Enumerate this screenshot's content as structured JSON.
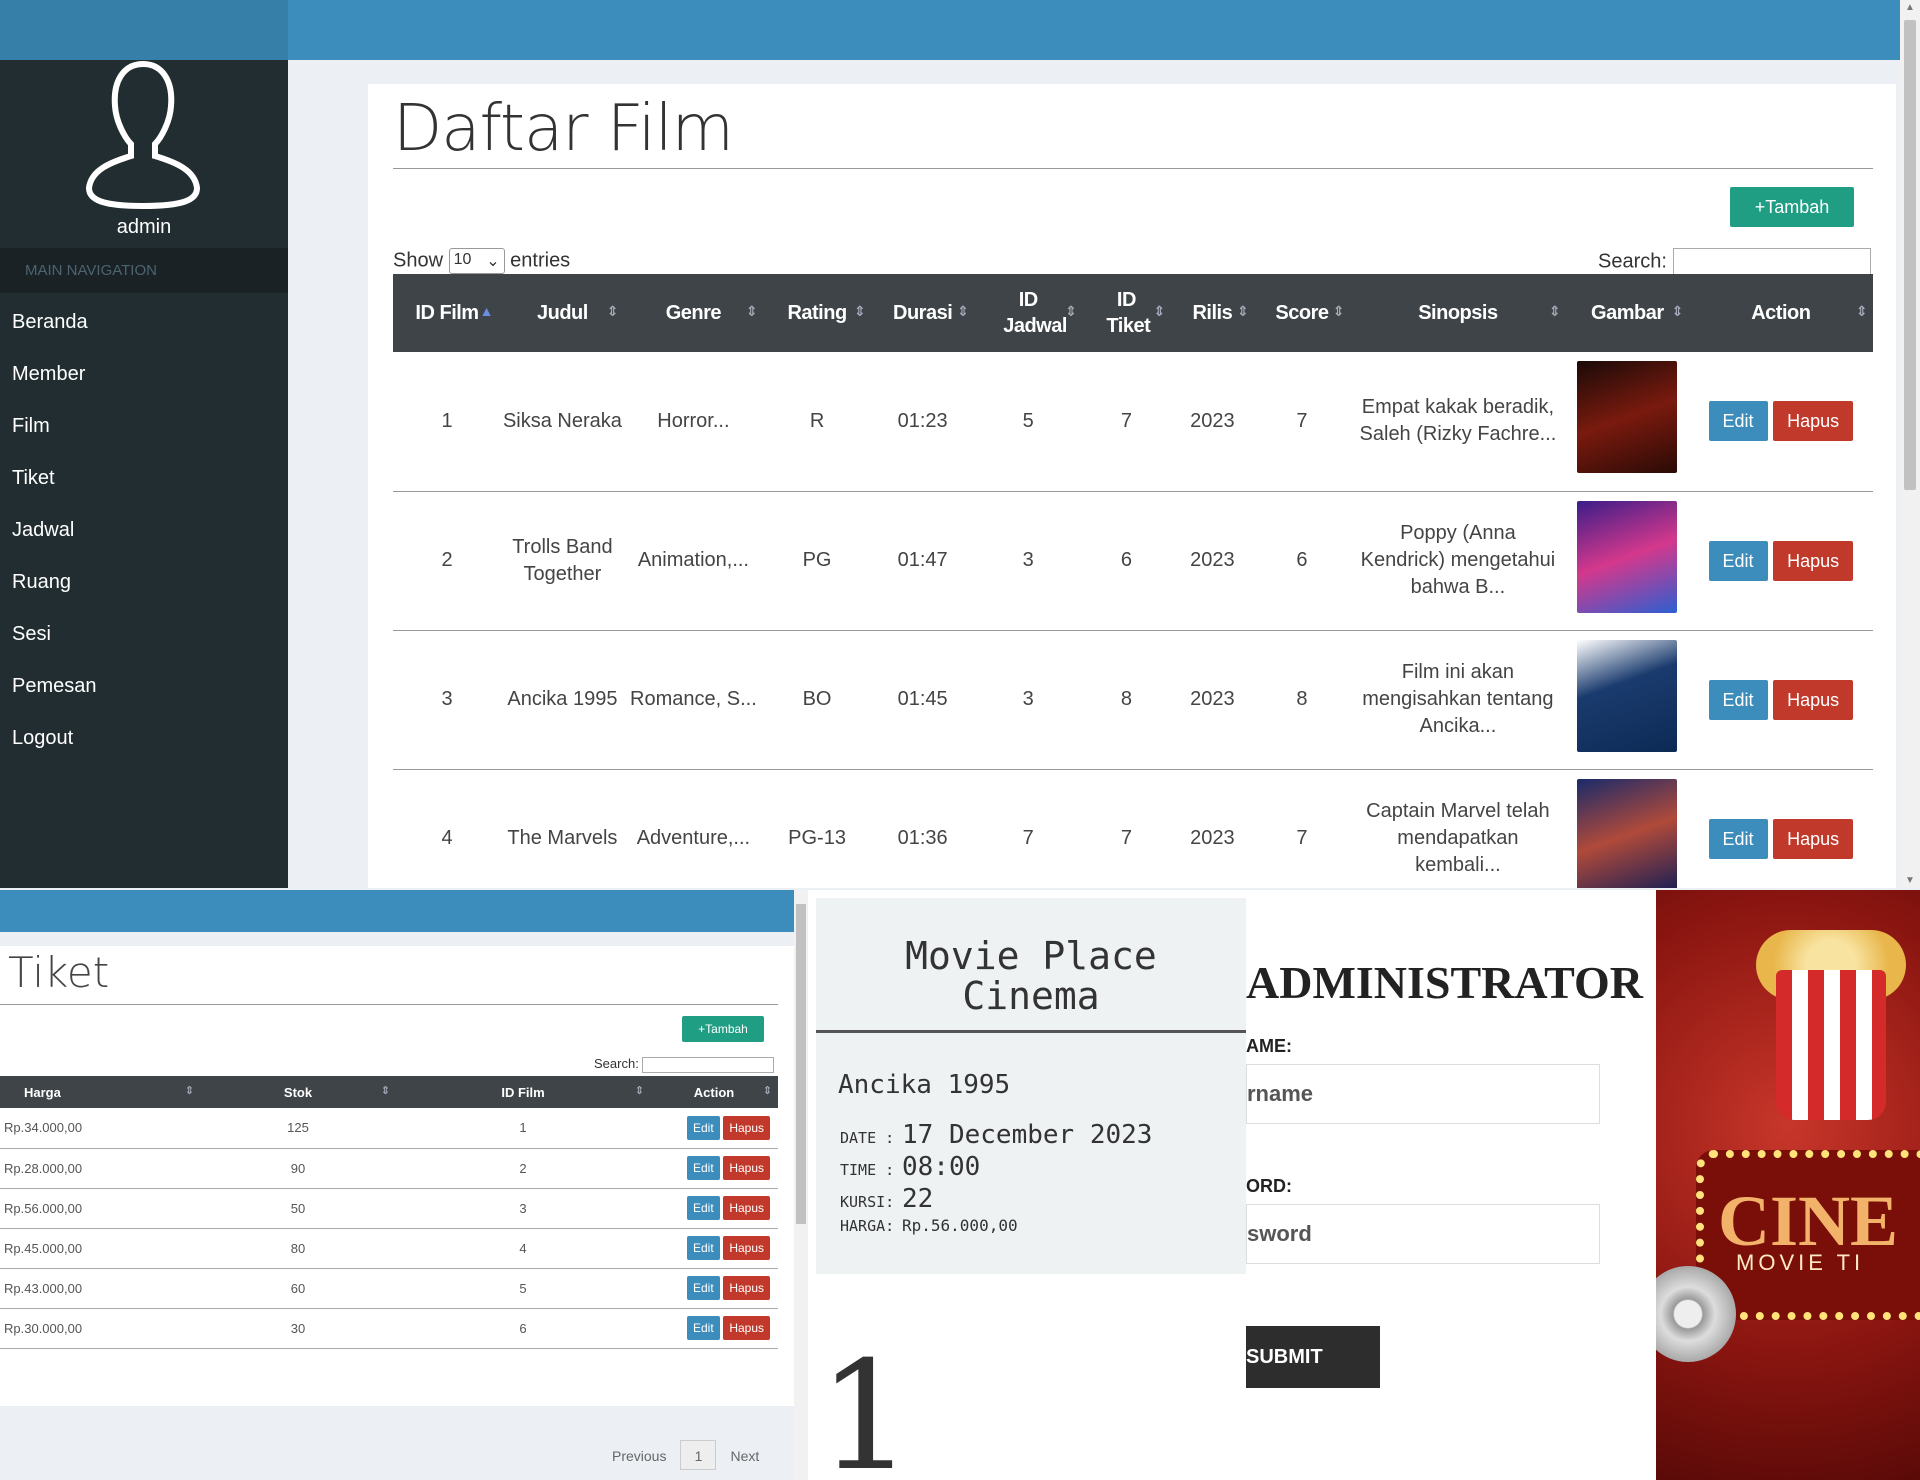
{
  "admin": {
    "username": "admin",
    "nav_header": "MAIN NAVIGATION",
    "nav_items": [
      "Beranda",
      "Member",
      "Film",
      "Tiket",
      "Jadwal",
      "Ruang",
      "Sesi",
      "Pemesan",
      "Logout"
    ],
    "page_title": "Daftar Film",
    "add_button": "+Tambah",
    "show_label": "Show",
    "entries_value": "10",
    "entries_label": "entries",
    "search_label": "Search:",
    "columns": [
      "ID Film",
      "Judul",
      "Genre",
      "Rating",
      "Durasi",
      "ID Jadwal",
      "ID Tiket",
      "Rilis",
      "Score",
      "Sinopsis",
      "Gambar",
      "Action"
    ],
    "rows": [
      {
        "id": "1",
        "judul": "Siksa Neraka",
        "genre": "Horror...",
        "rating": "R",
        "durasi": "01:23",
        "id_jadwal": "5",
        "id_tiket": "7",
        "rilis": "2023",
        "score": "7",
        "sinopsis": "Empat kakak beradik, Saleh (Rizky Fachre..."
      },
      {
        "id": "2",
        "judul": "Trolls Band Together",
        "genre": "Animation,...",
        "rating": "PG",
        "durasi": "01:47",
        "id_jadwal": "3",
        "id_tiket": "6",
        "rilis": "2023",
        "score": "6",
        "sinopsis": "Poppy (Anna Kendrick) mengetahui bahwa B..."
      },
      {
        "id": "3",
        "judul": "Ancika 1995",
        "genre": "Romance, S...",
        "rating": "BO",
        "durasi": "01:45",
        "id_jadwal": "3",
        "id_tiket": "8",
        "rilis": "2023",
        "score": "8",
        "sinopsis": "Film ini akan mengisahkan tentang Ancika..."
      },
      {
        "id": "4",
        "judul": "The Marvels",
        "genre": "Adventure,...",
        "rating": "PG-13",
        "durasi": "01:36",
        "id_jadwal": "7",
        "id_tiket": "7",
        "rilis": "2023",
        "score": "7",
        "sinopsis": "Captain Marvel telah mendapatkan kembali..."
      }
    ],
    "edit_label": "Edit",
    "delete_label": "Hapus"
  },
  "tiket": {
    "page_title": "Tiket",
    "add_button": "+Tambah",
    "search_label": "Search:",
    "columns": [
      "Harga",
      "Stok",
      "ID Film",
      "Action"
    ],
    "rows": [
      {
        "harga": "Rp.34.000,00",
        "stok": "125",
        "id_film": "1"
      },
      {
        "harga": "Rp.28.000,00",
        "stok": "90",
        "id_film": "2"
      },
      {
        "harga": "Rp.56.000,00",
        "stok": "50",
        "id_film": "3"
      },
      {
        "harga": "Rp.45.000,00",
        "stok": "80",
        "id_film": "4"
      },
      {
        "harga": "Rp.43.000,00",
        "stok": "60",
        "id_film": "5"
      },
      {
        "harga": "Rp.30.000,00",
        "stok": "30",
        "id_film": "6"
      }
    ],
    "edit_label": "Edit",
    "delete_label": "Hapus",
    "prev_label": "Previous",
    "page": "1",
    "next_label": "Next"
  },
  "ticket_print": {
    "cinema_line1": "Movie Place",
    "cinema_line2": "Cinema",
    "movie": "Ancika 1995",
    "date_label": "DATE",
    "date_value": "17 December 2023",
    "time_label": "TIME",
    "time_value": "08:00",
    "seat_label": "KURSI",
    "seat_value": "22",
    "price_label": "HARGA",
    "price_value": "Rp.56.000,00",
    "big_number": "1"
  },
  "login": {
    "title": "ADMINISTRATOR",
    "username_label": "AME:",
    "username_placeholder": "rname",
    "password_label": "ORD:",
    "password_placeholder": "sword",
    "submit": "SUBMIT"
  },
  "art": {
    "sign_text": "CINE",
    "sign_sub": "MOVIE TI"
  },
  "colors": {
    "header_blue": "#3c8dbc",
    "sidebar_dark": "#222d32",
    "btn_green": "#1f9e83",
    "btn_blue": "#3c8dbc",
    "btn_red": "#c0392b",
    "table_header": "#3e4447"
  }
}
